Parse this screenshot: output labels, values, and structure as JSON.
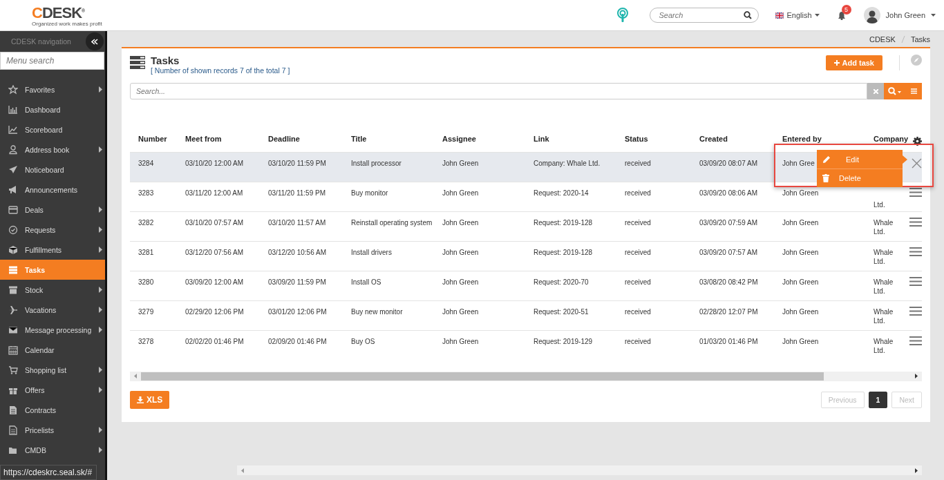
{
  "header": {
    "logo": "CDESK",
    "logo_mark": "®",
    "tagline": "Organized work makes profit",
    "search": {
      "placeholder": "Search"
    },
    "language": "English",
    "notifications": "5",
    "user": "John Green"
  },
  "sidebar": {
    "title": "CDESK navigation",
    "search": {
      "placeholder": "Menu search"
    },
    "items": [
      {
        "label": "Favorites",
        "submenu": true,
        "selected": false
      },
      {
        "label": "Dashboard",
        "submenu": false,
        "selected": false
      },
      {
        "label": "Scoreboard",
        "submenu": false,
        "selected": false
      },
      {
        "label": "Address book",
        "submenu": true,
        "selected": false
      },
      {
        "label": "Noticeboard",
        "submenu": false,
        "selected": false
      },
      {
        "label": "Announcements",
        "submenu": false,
        "selected": false
      },
      {
        "label": "Deals",
        "submenu": true,
        "selected": false
      },
      {
        "label": "Requests",
        "submenu": true,
        "selected": false
      },
      {
        "label": "Fulfillments",
        "submenu": true,
        "selected": false
      },
      {
        "label": "Tasks",
        "submenu": false,
        "selected": true
      },
      {
        "label": "Stock",
        "submenu": true,
        "selected": false
      },
      {
        "label": "Vacations",
        "submenu": true,
        "selected": false
      },
      {
        "label": "Message processing",
        "submenu": true,
        "selected": false
      },
      {
        "label": "Calendar",
        "submenu": false,
        "selected": false
      },
      {
        "label": "Shopping list",
        "submenu": true,
        "selected": false
      },
      {
        "label": "Offers",
        "submenu": true,
        "selected": false
      },
      {
        "label": "Contracts",
        "submenu": false,
        "selected": false
      },
      {
        "label": "Pricelists",
        "submenu": true,
        "selected": false
      },
      {
        "label": "CMDB",
        "submenu": true,
        "selected": false
      }
    ]
  },
  "breadcrumb": [
    "CDESK",
    "Tasks"
  ],
  "panel": {
    "title": "Tasks",
    "subtitle": "[ Number of shown records 7 of the total 7 ]",
    "add_button": "Add task",
    "search": {
      "placeholder": "Search..."
    },
    "export_button": "XLS"
  },
  "table": {
    "columns": [
      "Number",
      "Meet from",
      "Deadline",
      "Title",
      "Assignee",
      "Link",
      "Status",
      "Created",
      "Entered by",
      "Company"
    ],
    "rows": [
      {
        "selected": true,
        "menu_open": true,
        "cells": [
          "3284",
          "03/10/20 12:00 AM",
          "03/10/20 11:59 PM",
          "Install processor",
          "John Green",
          "Company: Whale Ltd.",
          "received",
          "03/09/20 08:07 AM",
          "John Gree",
          ""
        ]
      },
      {
        "selected": false,
        "menu_open": false,
        "cells": [
          "3283",
          "03/11/20 12:00 AM",
          "03/11/20 11:59 PM",
          "Buy monitor",
          "John Green",
          "Request: 2020-14",
          "received",
          "03/09/20 08:06 AM",
          "John Green",
          "Ltd."
        ]
      },
      {
        "selected": false,
        "menu_open": false,
        "cells": [
          "3282",
          "03/10/20 07:57 AM",
          "03/10/20 11:57 AM",
          "Reinstall operating system",
          "John Green",
          "Request: 2019-128",
          "received",
          "03/09/20 07:59 AM",
          "John Green",
          "Whale Ltd."
        ]
      },
      {
        "selected": false,
        "menu_open": false,
        "cells": [
          "3281",
          "03/12/20 07:56 AM",
          "03/12/20 10:56 AM",
          "Install drivers",
          "John Green",
          "Request: 2019-128",
          "received",
          "03/09/20 07:57 AM",
          "John Green",
          "Whale Ltd."
        ]
      },
      {
        "selected": false,
        "menu_open": false,
        "cells": [
          "3280",
          "03/09/20 12:00 AM",
          "03/09/20 11:59 PM",
          "Install OS",
          "John Green",
          "Request: 2020-70",
          "received",
          "03/08/20 08:42 PM",
          "John Green",
          "Whale Ltd."
        ]
      },
      {
        "selected": false,
        "menu_open": false,
        "cells": [
          "3279",
          "02/29/20 12:06 PM",
          "03/01/20 12:06 PM",
          "Buy new monitor",
          "John Green",
          "Request: 2020-51",
          "received",
          "02/28/20 12:07 PM",
          "John Green",
          "Whale Ltd."
        ]
      },
      {
        "selected": false,
        "menu_open": false,
        "cells": [
          "3278",
          "02/02/20 01:46 PM",
          "02/09/20 01:46 PM",
          "Buy OS",
          "John Green",
          "Request: 2019-129",
          "received",
          "01/03/20 01:46 PM",
          "John Green",
          "Whale Ltd."
        ]
      }
    ]
  },
  "context_menu": {
    "items": [
      {
        "kind": "edit",
        "label": "Edit"
      },
      {
        "kind": "delete",
        "label": "Delete"
      }
    ]
  },
  "pagination": {
    "previous": "Previous",
    "pages": [
      {
        "label": "1",
        "selected": true
      }
    ],
    "next": "Next",
    "previous_disabled": true,
    "next_disabled": true
  },
  "status_url": "https://cdeskrc.seal.sk/#"
}
